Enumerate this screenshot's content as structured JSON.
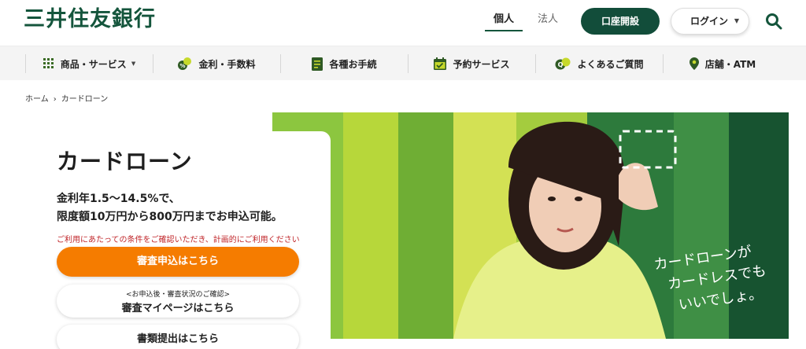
{
  "header": {
    "logo": "三井住友銀行",
    "segments": {
      "personal": "個人",
      "corporate": "法人"
    },
    "open_account": "口座開設",
    "login": "ログイン"
  },
  "nav": {
    "items": [
      {
        "label": "商品・サービス",
        "icon": "grid-icon"
      },
      {
        "label": "金利・手数料",
        "icon": "coins-icon"
      },
      {
        "label": "各種お手続",
        "icon": "document-icon"
      },
      {
        "label": "予約サービス",
        "icon": "calendar-icon"
      },
      {
        "label": "よくあるご質問",
        "icon": "faq-icon"
      },
      {
        "label": "店舗・ATM",
        "icon": "location-pin-icon"
      }
    ]
  },
  "breadcrumb": {
    "home": "ホーム",
    "current": "カードローン"
  },
  "hero": {
    "title": "カードローン",
    "line1": "金利年1.5〜14.5%で、",
    "line2": "限度額10万円から800万円までお申込可能。",
    "notice": "ご利用にあたっての条件をご確認いただき、計画的にご利用ください",
    "apply_button": "審査申込はこちら",
    "mypage_sub": "<お申込後・審査状況のご確認>",
    "mypage_button": "審査マイページはこちら",
    "docs_button": "書類提出はこちら",
    "image_caption": [
      "カードローンが",
      "カードレスでも",
      "いいでしょ。"
    ]
  },
  "colors": {
    "brand_green": "#14553c",
    "accent_orange": "#f57c00",
    "notice_red": "#c0262a"
  }
}
